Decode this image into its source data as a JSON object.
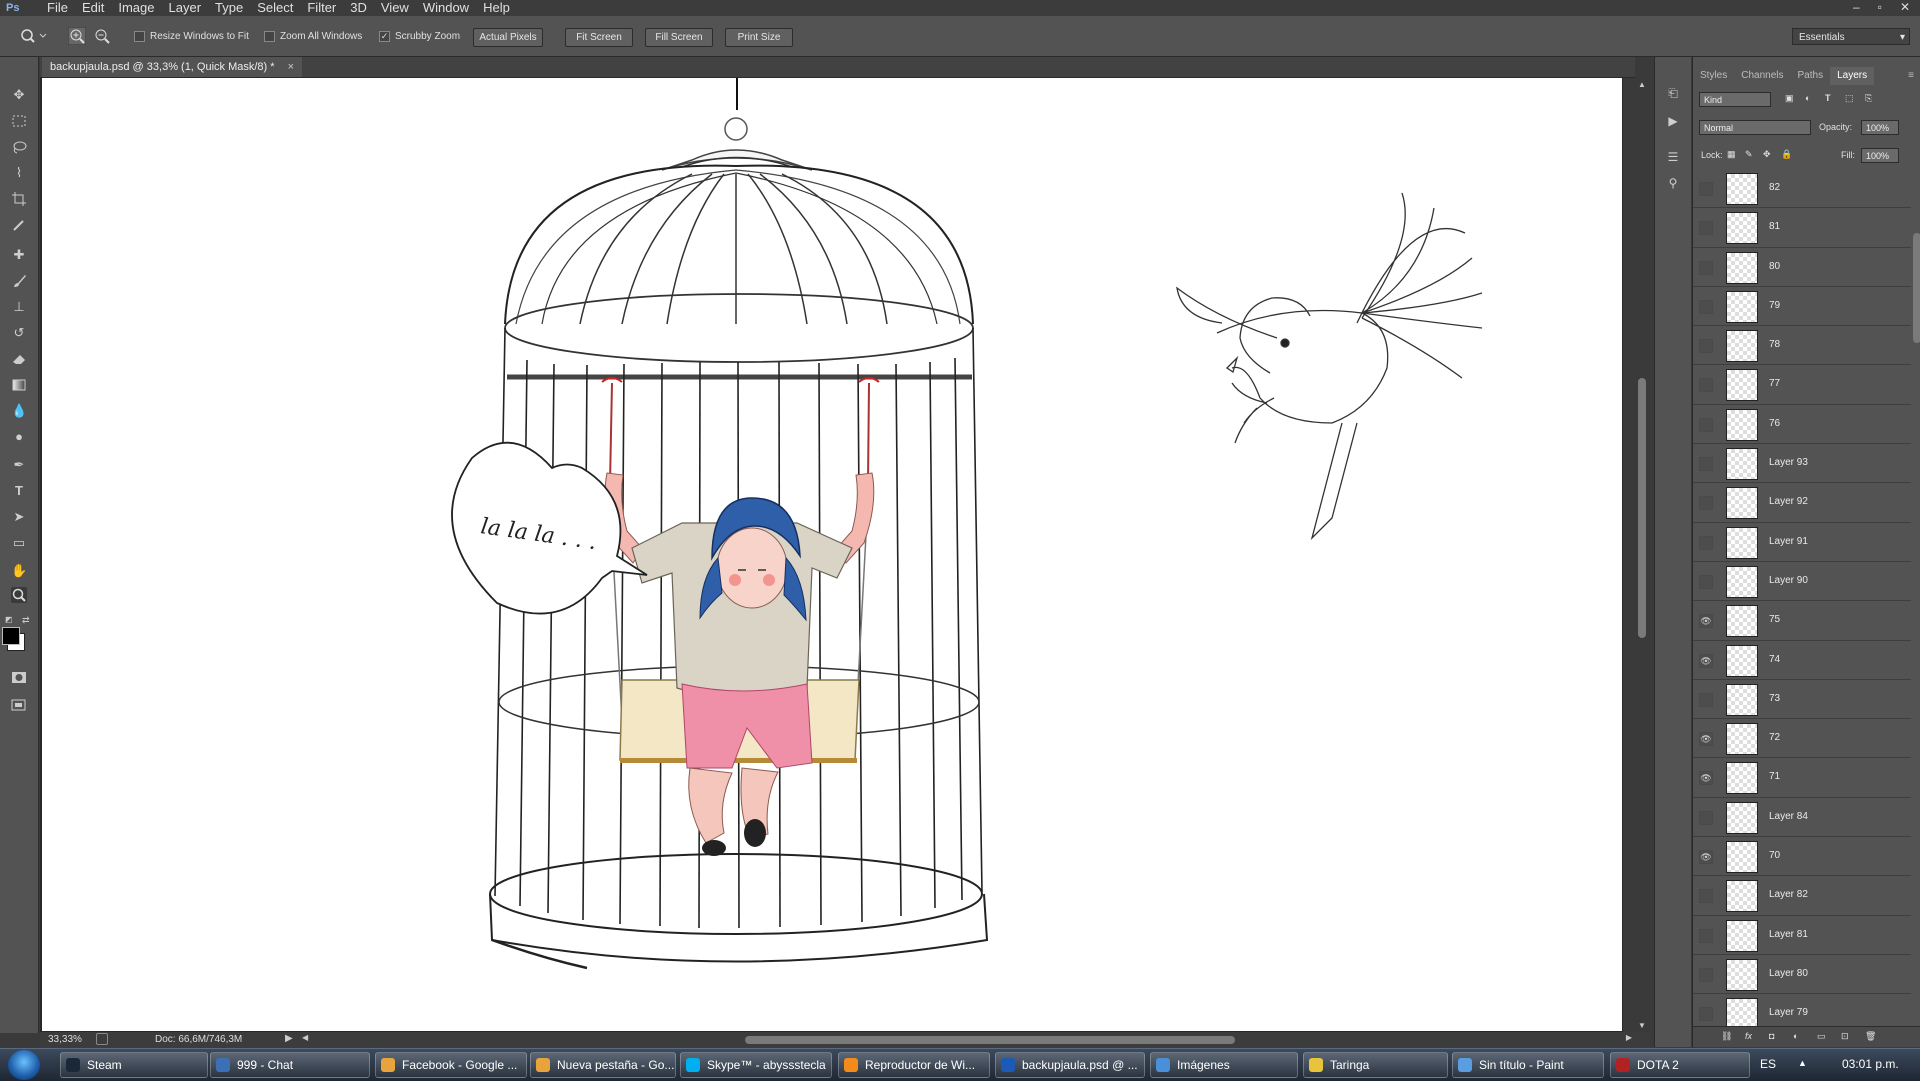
{
  "app": {
    "logo": "Ps"
  },
  "menu": [
    "File",
    "Edit",
    "Image",
    "Layer",
    "Type",
    "Select",
    "Filter",
    "3D",
    "View",
    "Window",
    "Help"
  ],
  "window_controls": {
    "minimize": "–",
    "restore": "▫",
    "close": "✕"
  },
  "options": {
    "resize_windows": "Resize Windows to Fit",
    "zoom_all": "Zoom All Windows",
    "scrubby_zoom": "Scrubby Zoom",
    "scrubby_checked": "✓",
    "actual_pixels": "Actual Pixels",
    "fit_screen": "Fit Screen",
    "fill_screen": "Fill Screen",
    "print_size": "Print Size",
    "workspace": "Essentials"
  },
  "document": {
    "tab_title": "backupjaula.psd @ 33,3% (1, Quick Mask/8) *",
    "tab_close": "×",
    "speech_text": "la la la . . .",
    "zoom": "33,33%",
    "doc_size": "Doc: 66,6M/746,3M"
  },
  "panel": {
    "tabs": [
      "Styles",
      "Channels",
      "Paths",
      "Layers"
    ],
    "active_tab": "Layers",
    "kind": "Kind",
    "blend_mode": "Normal",
    "opacity_label": "Opacity:",
    "opacity": "100%",
    "lock_label": "Lock:",
    "fill_label": "Fill:",
    "fill": "100%",
    "layers": [
      {
        "name": "82",
        "visible": false
      },
      {
        "name": "81",
        "visible": false
      },
      {
        "name": "80",
        "visible": false
      },
      {
        "name": "79",
        "visible": false
      },
      {
        "name": "78",
        "visible": false
      },
      {
        "name": "77",
        "visible": false
      },
      {
        "name": "76",
        "visible": false
      },
      {
        "name": "Layer 93",
        "visible": false
      },
      {
        "name": "Layer 92",
        "visible": false
      },
      {
        "name": "Layer 91",
        "visible": false
      },
      {
        "name": "Layer 90",
        "visible": false
      },
      {
        "name": "75",
        "visible": true
      },
      {
        "name": "74",
        "visible": true
      },
      {
        "name": "73",
        "visible": false
      },
      {
        "name": "72",
        "visible": true
      },
      {
        "name": "71",
        "visible": true
      },
      {
        "name": "Layer 84",
        "visible": false
      },
      {
        "name": "70",
        "visible": true
      },
      {
        "name": "Layer 82",
        "visible": false
      },
      {
        "name": "Layer 81",
        "visible": false
      },
      {
        "name": "Layer 80",
        "visible": false
      },
      {
        "name": "Layer 79",
        "visible": false
      }
    ]
  },
  "taskbar": {
    "items": [
      {
        "label": "Steam",
        "color": "#1b2838"
      },
      {
        "label": "999 - Chat",
        "color": "#3b6fb6"
      },
      {
        "label": "Facebook - Google ...",
        "color": "#e8a33c"
      },
      {
        "label": "Nueva pestaña - Go...",
        "color": "#e8a33c"
      },
      {
        "label": "Skype™ - abyssstecla",
        "color": "#00aff0"
      },
      {
        "label": "Reproductor de Wi...",
        "color": "#f28a1c"
      },
      {
        "label": "backupjaula.psd @ ...",
        "color": "#1c5ab8"
      },
      {
        "label": "Imágenes",
        "color": "#4a90d9"
      },
      {
        "label": "Taringa",
        "color": "#e8c33c"
      },
      {
        "label": "Sin título - Paint",
        "color": "#5a9de0"
      },
      {
        "label": "DOTA 2",
        "color": "#b22222"
      }
    ],
    "lang": "ES",
    "tray_arrow": "▲",
    "time": "03:01 p.m."
  }
}
